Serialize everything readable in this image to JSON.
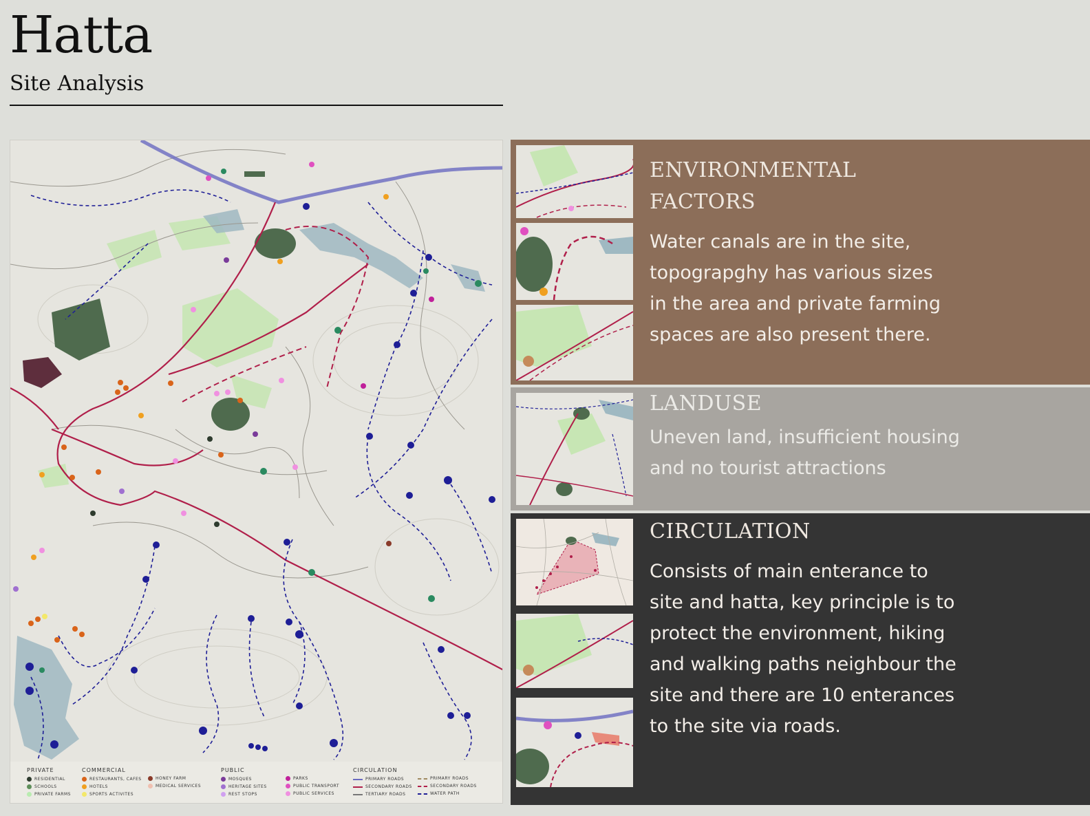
{
  "header": {
    "title": "Hatta",
    "subtitle": "Site Analysis"
  },
  "colors": {
    "background": "#dedfda",
    "environmental_panel": "#8c6e59",
    "landuse_panel": "#a8a5a0",
    "circulation_panel": "#343434",
    "primary_road": "#b01f4a",
    "water_path": "#1e1e96",
    "green_area": "#c7e6b4",
    "water": "#9fb9c2"
  },
  "legend": {
    "private": {
      "heading": "PRIVATE",
      "items": [
        {
          "label": "RESIDENTIAL",
          "color": "#2e3b2e"
        },
        {
          "label": "SCHOOLS",
          "color": "#5e8f5a"
        },
        {
          "label": "PRIVATE FARMS",
          "color": "#b9ecb0"
        }
      ]
    },
    "commercial": {
      "heading": "COMMERCIAL",
      "items": [
        {
          "label": "RESTAURANTS, CAFES",
          "color": "#d9641a"
        },
        {
          "label": "HOTELS",
          "color": "#f0a020"
        },
        {
          "label": "SPORTS ACTIVITES",
          "color": "#f3e86a"
        },
        {
          "label": "HONEY FARM",
          "color": "#8a3b2a"
        },
        {
          "label": "MEDICAL SERVICES",
          "color": "#f0c0b0"
        }
      ]
    },
    "public": {
      "heading": "PUBLIC",
      "items": [
        {
          "label": "MOSQUES",
          "color": "#7a3b9a"
        },
        {
          "label": "HERITAGE SITES",
          "color": "#a070d0"
        },
        {
          "label": "REST STOPS",
          "color": "#d0a0f0"
        },
        {
          "label": "PARKS",
          "color": "#c0209a"
        },
        {
          "label": "PUBLIC TRANSPORT",
          "color": "#e050c0"
        },
        {
          "label": "PUBLIC SERVICES",
          "color": "#f090e0"
        }
      ]
    },
    "circulation": {
      "heading": "CIRCULATION",
      "items": [
        {
          "label": "PRIMARY ROADS",
          "color": "#6a6ac0"
        },
        {
          "label": "SECONDARY ROADS",
          "color": "#b01f4a"
        },
        {
          "label": "TERTIARY ROADS",
          "color": "#777777"
        },
        {
          "label": "PRIMARY ROADS",
          "color": "#a08a60"
        },
        {
          "label": "SECONDARY ROADS",
          "color": "#b01f4a"
        },
        {
          "label": "WATER PATH",
          "color": "#1e1e96"
        }
      ]
    }
  },
  "sections": {
    "environmental": {
      "heading_line1": "ENVIRONMENTAL",
      "heading_line2": "FACTORS",
      "body": [
        "Water canals are in the site,",
        "topograpghy has various sizes",
        "in the area and private farming",
        "spaces are also present there."
      ]
    },
    "landuse": {
      "heading": "LANDUSE",
      "body": [
        "Uneven land, insufficient housing",
        "and no tourist attractions"
      ]
    },
    "circulation": {
      "heading": "CIRCULATION",
      "body": [
        "Consists of main enterance to",
        "site and hatta, key principle is to",
        "protect the environment, hiking",
        "and walking paths neighbour the",
        "site and there are 10 enterances",
        "to the site via roads."
      ]
    }
  }
}
